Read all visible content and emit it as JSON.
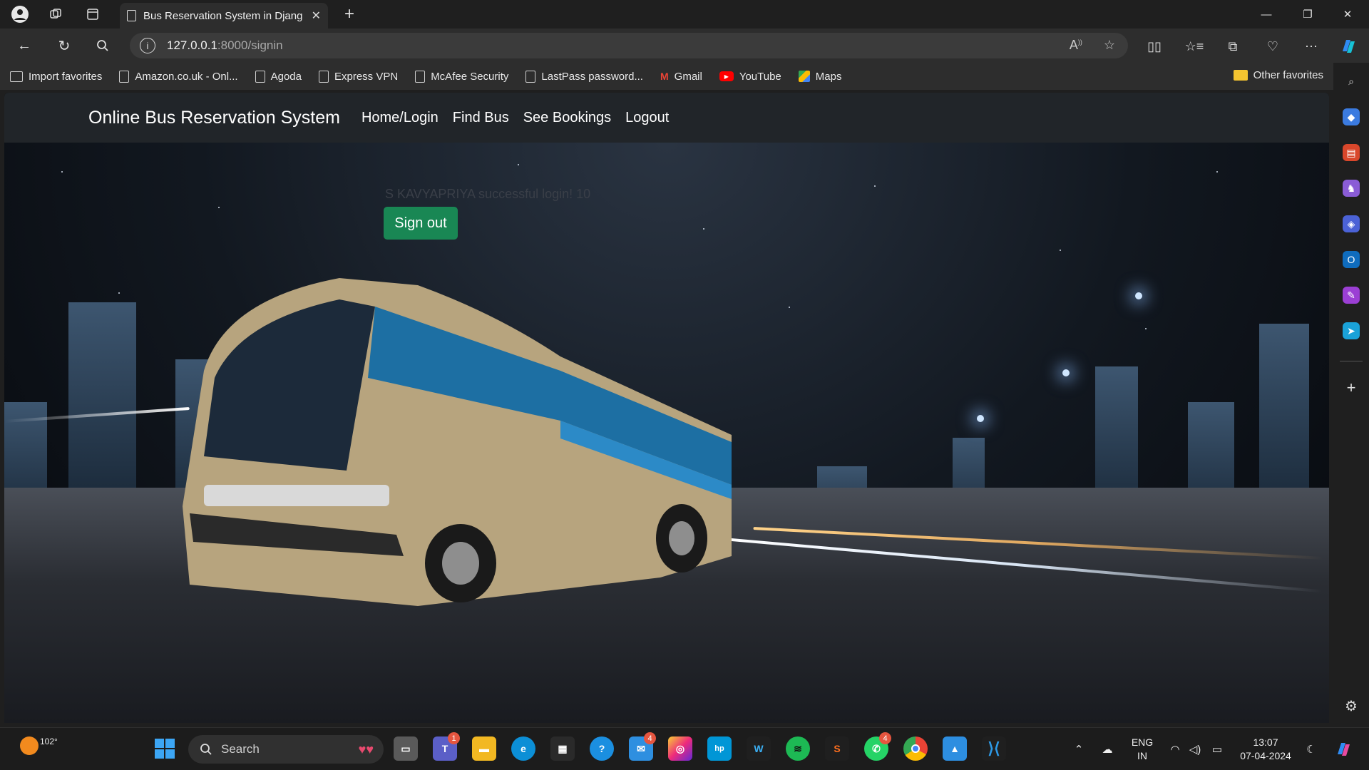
{
  "browser": {
    "tab_title": "Bus Reservation System in Djang",
    "url_host": "127.0.0.1",
    "url_path": ":8000/signin",
    "bookmarks": [
      {
        "label": "Import favorites",
        "icon": "import-icon"
      },
      {
        "label": "Amazon.co.uk - Onl...",
        "icon": "page-icon"
      },
      {
        "label": "Agoda",
        "icon": "page-icon"
      },
      {
        "label": "Express VPN",
        "icon": "page-icon"
      },
      {
        "label": "McAfee Security",
        "icon": "page-icon"
      },
      {
        "label": "LastPass password...",
        "icon": "page-icon"
      },
      {
        "label": "Gmail",
        "icon": "gmail-icon"
      },
      {
        "label": "YouTube",
        "icon": "youtube-icon"
      },
      {
        "label": "Maps",
        "icon": "maps-icon"
      }
    ],
    "other_favorites": "Other favorites"
  },
  "page": {
    "brand": "Online Bus Reservation System",
    "nav": [
      "Home/Login",
      "Find Bus",
      "See Bookings",
      "Logout"
    ],
    "message": "S KAVYAPRIYA successful login! 10",
    "signout_label": "Sign out"
  },
  "taskbar": {
    "temperature": "102°",
    "search_placeholder": "Search",
    "badges": {
      "teams": "1",
      "mail": "4",
      "whatsapp": "4"
    },
    "language": "ENG",
    "region": "IN",
    "time": "13:07",
    "date": "07-04-2024"
  },
  "colors": {
    "signout_button": "#198754",
    "navbar": "#212529",
    "browser_chrome": "#2d2d2d"
  }
}
